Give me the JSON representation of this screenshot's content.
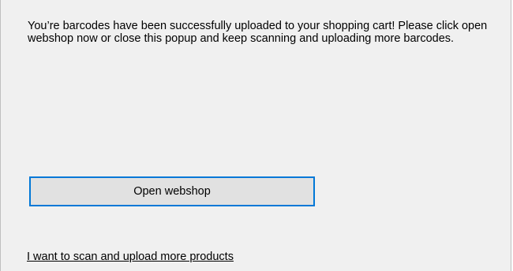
{
  "dialog": {
    "message": "You’re barcodes have been successfully uploaded to your shopping cart! Please click open webshop now or close this popup and keep scanning and uploading more barcodes.",
    "open_webshop_label": "Open webshop",
    "scan_more_link": "I want to scan and upload more products"
  },
  "colors": {
    "background": "#f0f0f0",
    "button_face": "#e1e1e1",
    "focus_border": "#0078d7"
  }
}
